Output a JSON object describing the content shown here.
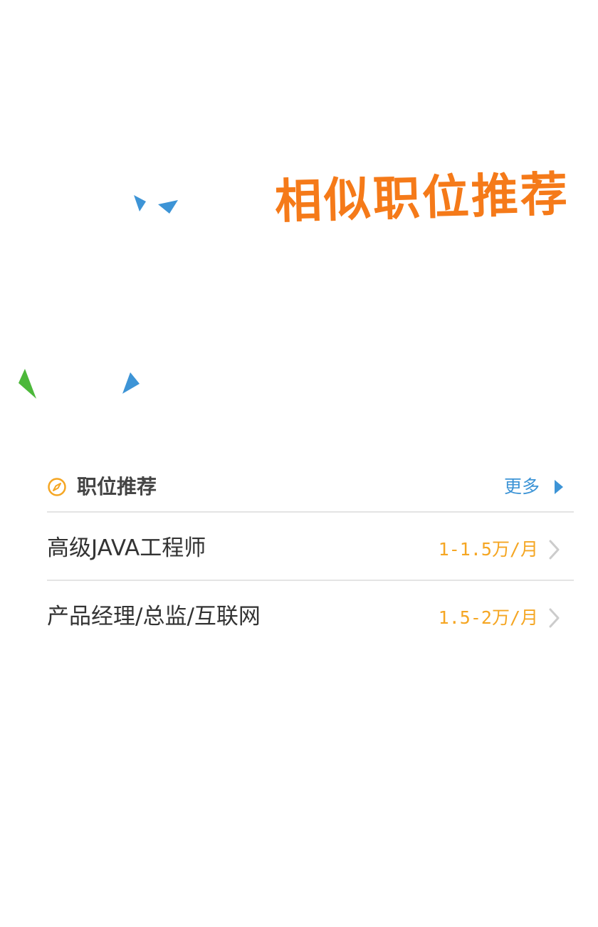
{
  "banner": {
    "title": "相似职位推荐"
  },
  "section": {
    "title": "职位推荐",
    "icon": "compass-icon",
    "more_label": "更多",
    "more_icon": "triangle-right-icon"
  },
  "jobs": [
    {
      "title": "高级JAVA工程师",
      "salary": "1-1.5万/月",
      "icon": "chevron-right-icon"
    },
    {
      "title": "产品经理/总监/互联网",
      "salary": "1.5-2万/月",
      "icon": "chevron-right-icon"
    }
  ],
  "colors": {
    "banner_title": "#f57a19",
    "accent_blue": "#3d94d6",
    "salary_orange": "#f5a623",
    "icon_orange": "#f5a623",
    "confetti_green": "#4cb83a",
    "chevron_gray": "#cccccc"
  }
}
